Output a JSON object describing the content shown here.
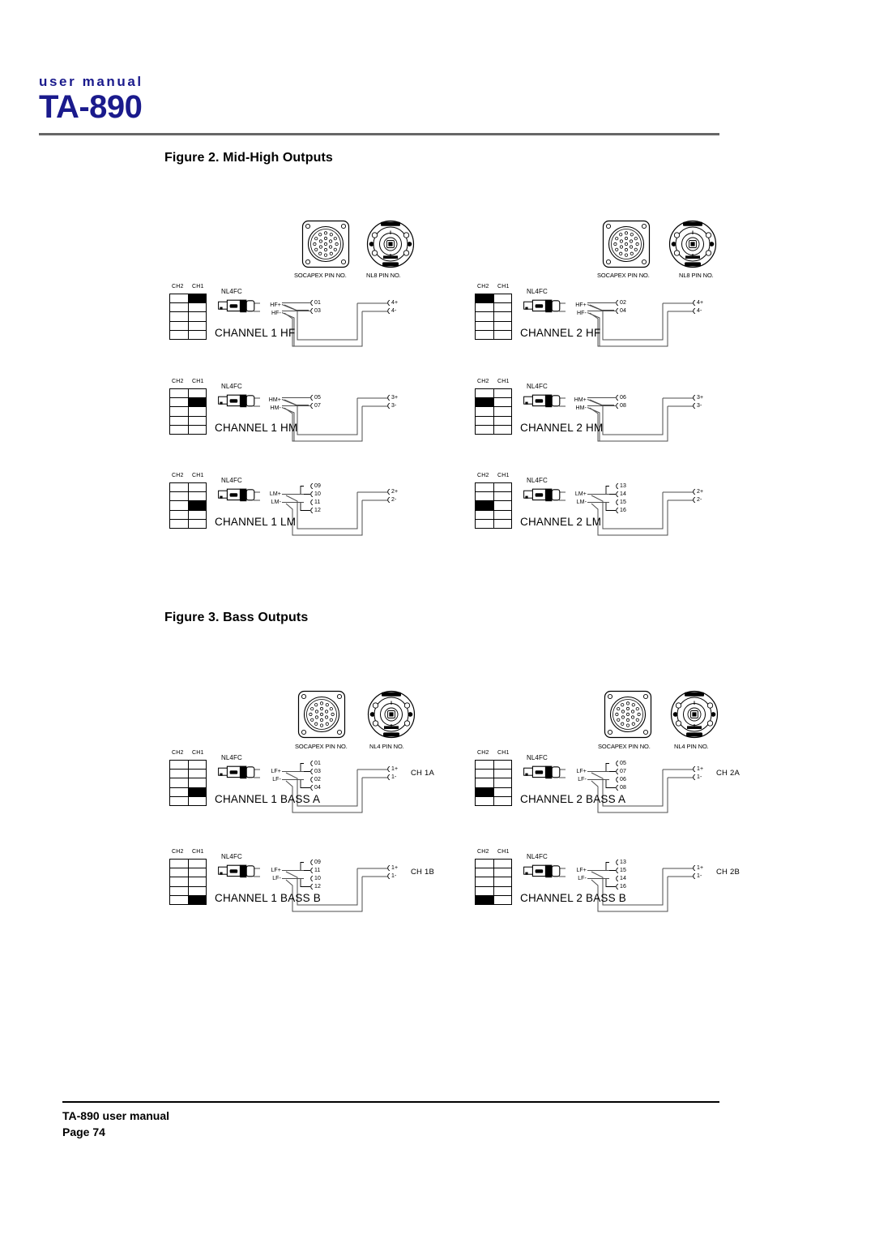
{
  "header": {
    "kicker": "user manual",
    "title": "TA-890",
    "accent_color": "#1a1a8c"
  },
  "figures": [
    {
      "id": "figure-2",
      "caption": "Figure 2. Mid-High Outputs"
    },
    {
      "id": "figure-3",
      "caption": "Figure 3. Bass Outputs"
    }
  ],
  "connector_captions": {
    "socapex": "SOCAPEX PIN NO.",
    "nl8": "NL8 PIN NO.",
    "nl4": "NL4 PIN NO."
  },
  "matrix_headers": {
    "col2": "CH2",
    "col1": "CH1"
  },
  "plug_label": "NL4FC",
  "blocks": [
    {
      "name": "CHANNEL 1 HF",
      "figure": "figure-2",
      "matrix_row": 1,
      "matrix_col": "CH1",
      "signals": [
        "HF+",
        "HF-"
      ],
      "socapex_pins": [
        "01",
        "03"
      ],
      "out_pins": [
        "4+",
        "4-"
      ]
    },
    {
      "name": "CHANNEL 2 HF",
      "figure": "figure-2",
      "matrix_row": 1,
      "matrix_col": "CH2",
      "signals": [
        "HF+",
        "HF-"
      ],
      "socapex_pins": [
        "02",
        "04"
      ],
      "out_pins": [
        "4+",
        "4-"
      ]
    },
    {
      "name": "CHANNEL 1 HM",
      "figure": "figure-2",
      "matrix_row": 2,
      "matrix_col": "CH1",
      "signals": [
        "HM+",
        "HM-"
      ],
      "socapex_pins": [
        "05",
        "07"
      ],
      "out_pins": [
        "3+",
        "3-"
      ]
    },
    {
      "name": "CHANNEL 2 HM",
      "figure": "figure-2",
      "matrix_row": 2,
      "matrix_col": "CH2",
      "signals": [
        "HM+",
        "HM-"
      ],
      "socapex_pins": [
        "06",
        "08"
      ],
      "out_pins": [
        "3+",
        "3-"
      ]
    },
    {
      "name": "CHANNEL 1 LM",
      "figure": "figure-2",
      "matrix_row": 3,
      "matrix_col": "CH1",
      "signals": [
        "LM+",
        "LM-"
      ],
      "socapex_pins": [
        "09",
        "10",
        "11",
        "12"
      ],
      "out_pins": [
        "2+",
        "2-"
      ]
    },
    {
      "name": "CHANNEL 2 LM",
      "figure": "figure-2",
      "matrix_row": 3,
      "matrix_col": "CH2",
      "signals": [
        "LM+",
        "LM-"
      ],
      "socapex_pins": [
        "13",
        "14",
        "15",
        "16"
      ],
      "out_pins": [
        "2+",
        "2-"
      ]
    },
    {
      "name": "CHANNEL 1 BASS A",
      "figure": "figure-3",
      "matrix_row": 4,
      "matrix_col": "CH1",
      "signals": [
        "LF+",
        "LF-"
      ],
      "socapex_pins": [
        "01",
        "03",
        "02",
        "04"
      ],
      "out_pins": [
        "1+",
        "1-"
      ],
      "out_tag": "CH 1A"
    },
    {
      "name": "CHANNEL 2 BASS A",
      "figure": "figure-3",
      "matrix_row": 4,
      "matrix_col": "CH2",
      "signals": [
        "LF+",
        "LF-"
      ],
      "socapex_pins": [
        "05",
        "07",
        "06",
        "08"
      ],
      "out_pins": [
        "1+",
        "1-"
      ],
      "out_tag": "CH 2A"
    },
    {
      "name": "CHANNEL 1 BASS B",
      "figure": "figure-3",
      "matrix_row": 5,
      "matrix_col": "CH1",
      "signals": [
        "LF+",
        "LF-"
      ],
      "socapex_pins": [
        "09",
        "11",
        "10",
        "12"
      ],
      "out_pins": [
        "1+",
        "1-"
      ],
      "out_tag": "CH 1B"
    },
    {
      "name": "CHANNEL 2 BASS B",
      "figure": "figure-3",
      "matrix_row": 5,
      "matrix_col": "CH2",
      "signals": [
        "LF+",
        "LF-"
      ],
      "socapex_pins": [
        "13",
        "15",
        "14",
        "16"
      ],
      "out_pins": [
        "1+",
        "1-"
      ],
      "out_tag": "CH 2B"
    }
  ],
  "footer": {
    "line1": "TA-890 user manual",
    "line2": "Page 74"
  }
}
